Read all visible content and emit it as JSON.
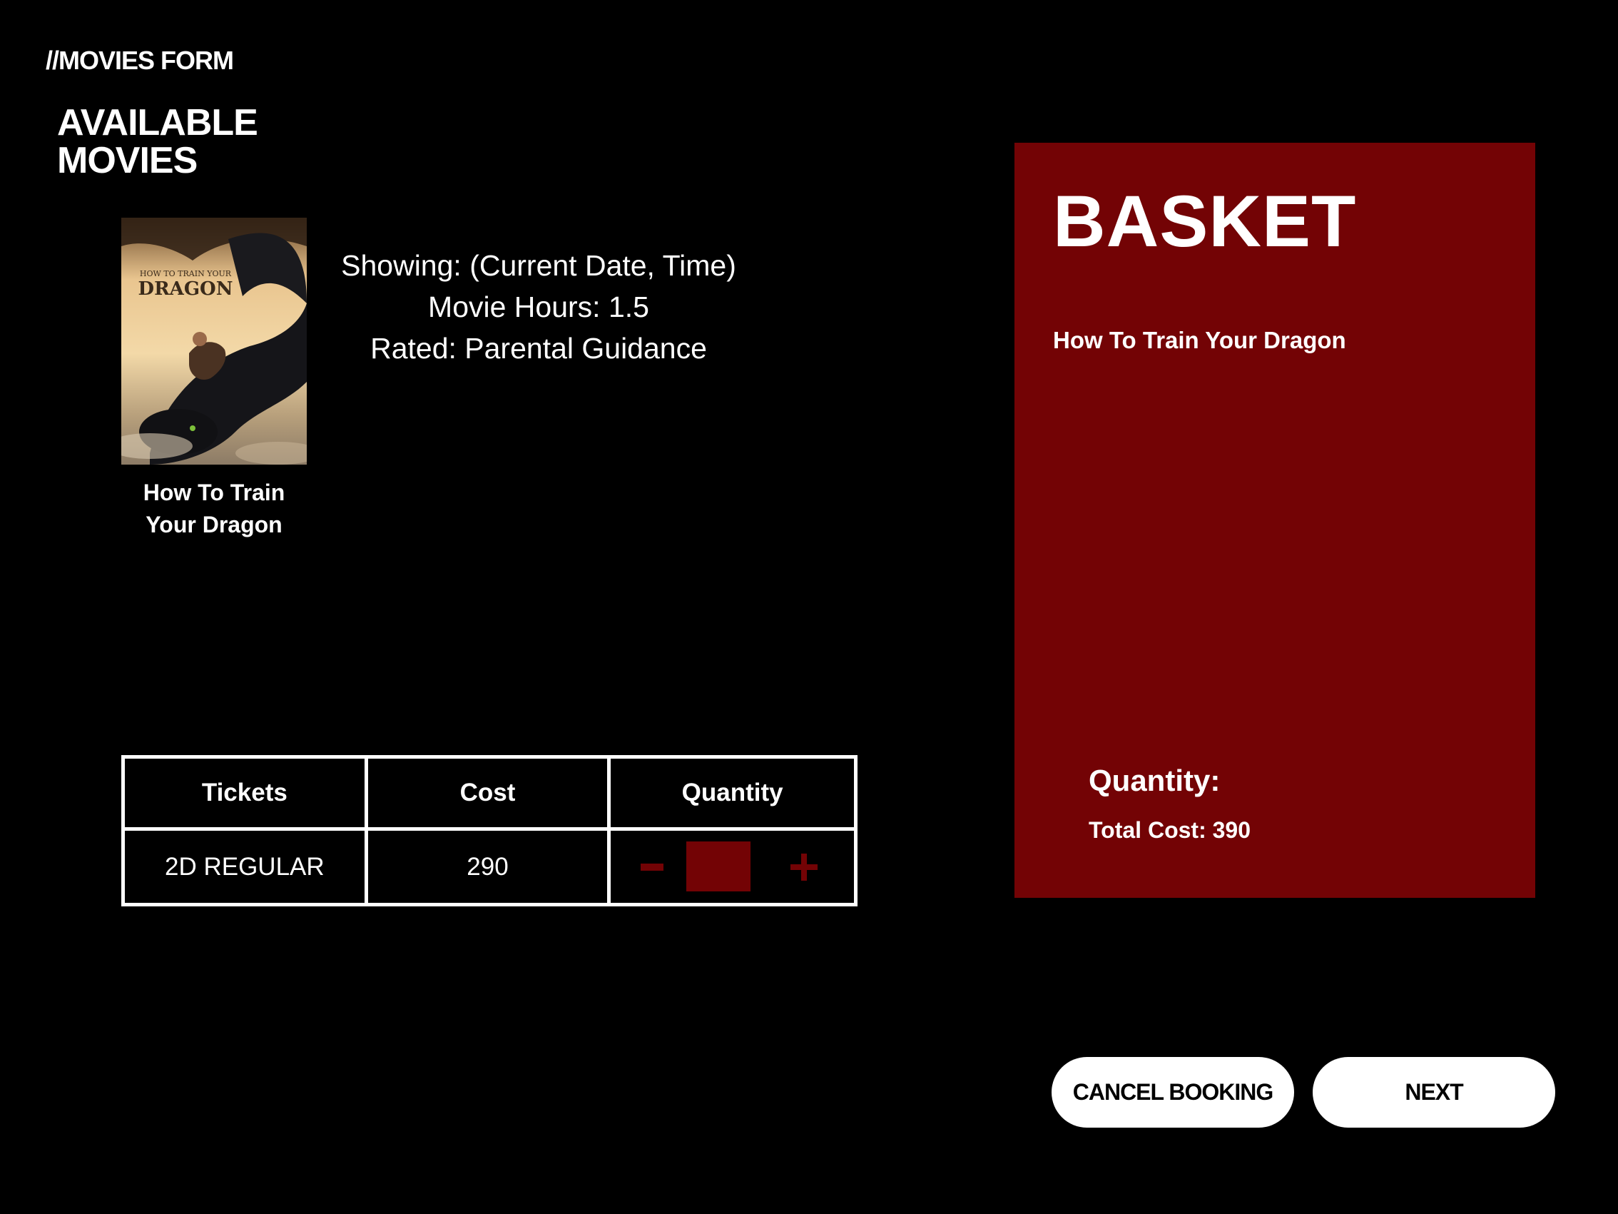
{
  "header": {
    "breadcrumb": "//MOVIES FORM",
    "title_line1": "AVAILABLE",
    "title_line2": "MOVIES"
  },
  "movie": {
    "poster_title_small": "HOW TO TRAIN YOUR",
    "poster_title_big": "DRAGON",
    "caption_line1": "How To Train",
    "caption_line2": "Your Dragon",
    "showing": "Showing: (Current Date, Time)",
    "hours": "Movie Hours: 1.5",
    "rated": "Rated: Parental Guidance"
  },
  "ticket_table": {
    "headers": [
      "Tickets",
      "Cost",
      "Quantity"
    ],
    "rows": [
      {
        "ticket": "2D REGULAR",
        "cost": "290",
        "quantity": ""
      }
    ],
    "minus_label": "−",
    "plus_label": "+"
  },
  "basket": {
    "title": "BASKET",
    "item": "How To Train Your Dragon",
    "quantity_label": "Quantity:",
    "total_cost": "Total Cost: 390"
  },
  "buttons": {
    "cancel": "CANCEL BOOKING",
    "next": "NEXT"
  },
  "colors": {
    "background": "#000000",
    "accent": "#730305",
    "text": "#ffffff",
    "button_bg": "#ffffff"
  },
  "icons": {
    "minus": "minus-icon",
    "plus": "plus-icon"
  }
}
